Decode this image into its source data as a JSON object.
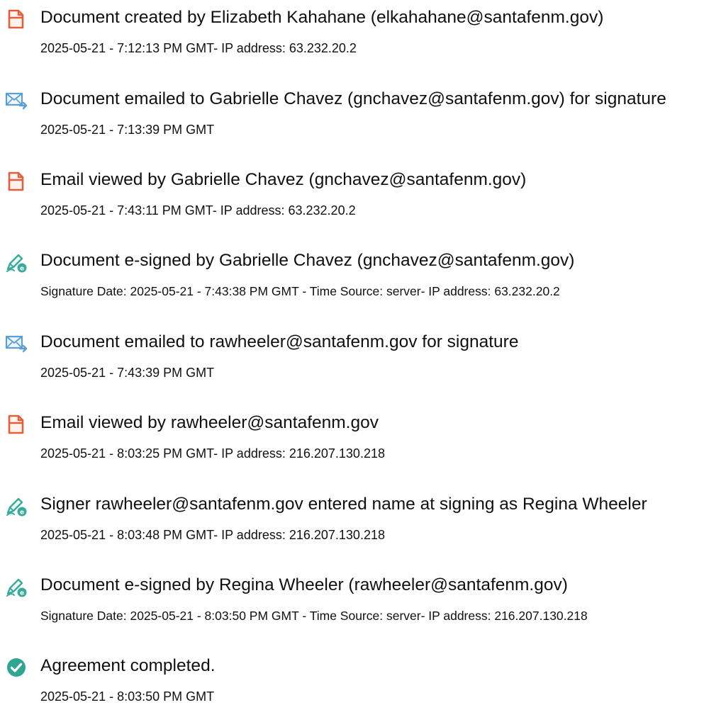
{
  "colors": {
    "document_icon": "#e25f39",
    "email_icon": "#5a9fd6",
    "sign_icon": "#3aaa9c",
    "complete_icon": "#2fa592"
  },
  "events": [
    {
      "icon": "document-created-icon",
      "title": "Document created by Elizabeth Kahahane (elkahahane@santafenm.gov)",
      "detail": "2025-05-21 - 7:12:13 PM GMT- IP address: 63.232.20.2"
    },
    {
      "icon": "email-sent-icon",
      "title": "Document emailed to Gabrielle Chavez (gnchavez@santafenm.gov) for signature",
      "detail": "2025-05-21 - 7:13:39 PM GMT"
    },
    {
      "icon": "document-viewed-icon",
      "title": "Email viewed by Gabrielle Chavez (gnchavez@santafenm.gov)",
      "detail": "2025-05-21 - 7:43:11 PM GMT- IP address: 63.232.20.2"
    },
    {
      "icon": "e-sign-icon",
      "title": "Document e-signed by Gabrielle Chavez (gnchavez@santafenm.gov)",
      "detail": "Signature Date: 2025-05-21 - 7:43:38 PM GMT - Time Source: server- IP address: 63.232.20.2"
    },
    {
      "icon": "email-sent-icon",
      "title": "Document emailed to rawheeler@santafenm.gov for signature",
      "detail": "2025-05-21 - 7:43:39 PM GMT"
    },
    {
      "icon": "document-viewed-icon",
      "title": "Email viewed by rawheeler@santafenm.gov",
      "detail": "2025-05-21 - 8:03:25 PM GMT- IP address: 216.207.130.218"
    },
    {
      "icon": "e-sign-icon",
      "title": "Signer rawheeler@santafenm.gov entered name at signing as Regina Wheeler",
      "detail": "2025-05-21 - 8:03:48 PM GMT- IP address: 216.207.130.218"
    },
    {
      "icon": "e-sign-icon",
      "title": "Document e-signed by Regina Wheeler (rawheeler@santafenm.gov)",
      "detail": "Signature Date: 2025-05-21 - 8:03:50 PM GMT - Time Source: server- IP address: 216.207.130.218"
    },
    {
      "icon": "check-circle-icon",
      "title": "Agreement completed.",
      "detail": "2025-05-21 - 8:03:50 PM GMT"
    }
  ]
}
